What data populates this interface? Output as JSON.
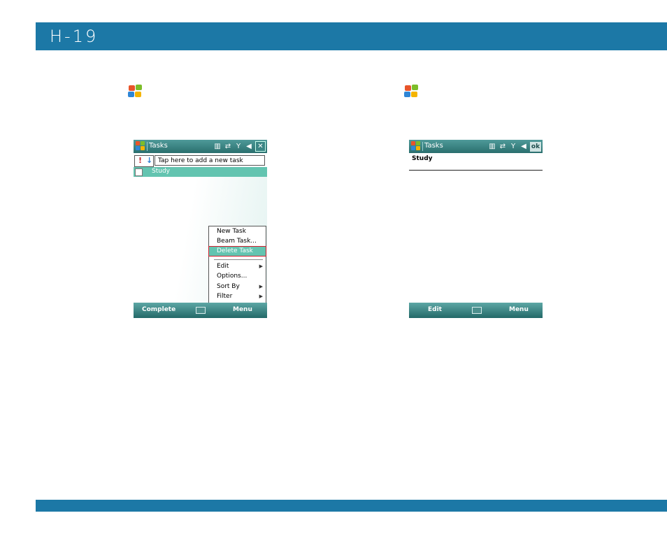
{
  "header": {
    "page_number": "H-19"
  },
  "colors": {
    "brand_bar": "#1c78a6",
    "accent_teal": "#63c4b0",
    "highlight_border": "#d62030"
  },
  "left_screen": {
    "title": "Tasks",
    "status_icons": [
      "keyboard-icon",
      "sync-icon",
      "signal-off-icon",
      "speaker-mute-icon",
      "close-icon"
    ],
    "close_label": "✕",
    "new_task_placeholder": "Tap here to add a new task",
    "priority_high": "!",
    "priority_low": "↓",
    "task_name": "Study",
    "menu_items": [
      {
        "label": "New Task"
      },
      {
        "label": "Beam Task..."
      },
      {
        "label": "Delete Task",
        "selected": true
      },
      {
        "label": "Edit",
        "submenu": true
      },
      {
        "label": "Options..."
      },
      {
        "label": "Sort By",
        "submenu": true
      },
      {
        "label": "Filter",
        "submenu": true
      }
    ],
    "softkey_left": "Complete",
    "softkey_right": "Menu"
  },
  "right_screen": {
    "title": "Tasks",
    "ok_label": "ok",
    "detail_title": "Study",
    "softkey_left": "Edit",
    "softkey_right": "Menu"
  }
}
